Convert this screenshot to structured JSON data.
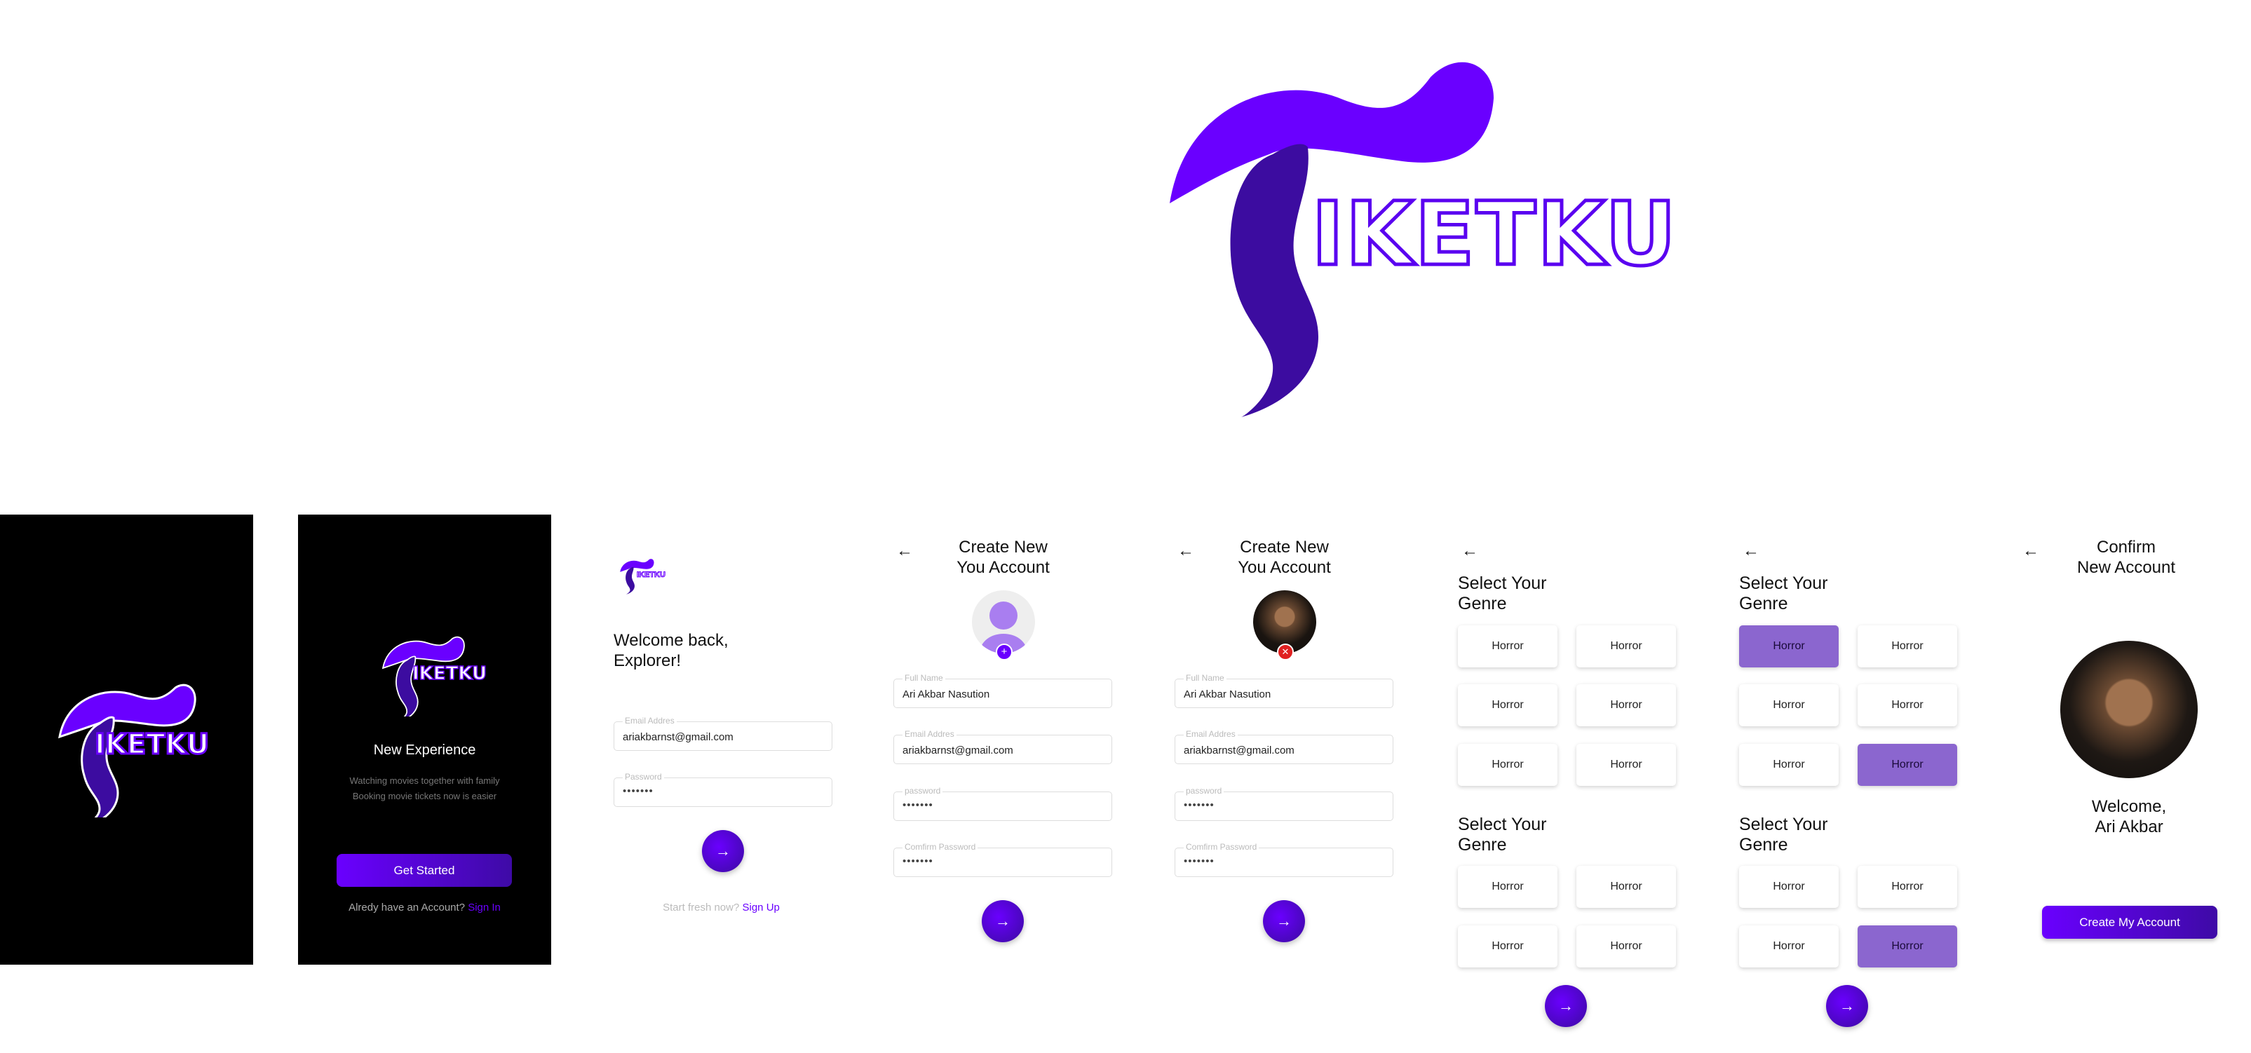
{
  "brand": {
    "name": "IKETKU",
    "logo_letter": "T"
  },
  "colors": {
    "accent": "#6a00ff",
    "accent_dark": "#3e0aa6",
    "selected_genre": "#8b66cf",
    "dark_bg": "#000000"
  },
  "icons": {
    "back": "arrow-left-icon",
    "next": "arrow-right-icon",
    "add_photo": "plus-circle-icon",
    "remove_photo": "close-circle-icon"
  },
  "splash": {
    "brand": "IKETKU"
  },
  "onboarding": {
    "brand": "IKETKU",
    "title": "New Experience",
    "subtitle_line1": "Watching movies together with family",
    "subtitle_line2": "Booking movie tickets now is easier",
    "cta_label": "Get Started",
    "signin_prompt": "Alredy have an Account?",
    "signin_link": "Sign In"
  },
  "login": {
    "brand": "IKETKU",
    "welcome_line1": "Welcome back,",
    "welcome_line2": "Explorer!",
    "email_label": "Email Addres",
    "email_value": "ariakbarnst@gmail.com",
    "password_label": "Password",
    "password_value": "•••••••",
    "signup_prompt": "Start fresh now?",
    "signup_link": "Sign Up"
  },
  "signup": {
    "title_line1": "Create New",
    "title_line2": "You Account",
    "fullname_label": "Full Name",
    "fullname_value": "Ari Akbar Nasution",
    "email_label": "Email Addres",
    "email_value": "ariakbarnst@gmail.com",
    "password_label": "password",
    "password_value": "•••••••",
    "confirm_label": "Comfirm Password",
    "confirm_value": "•••••••"
  },
  "genre": {
    "title_line1": "Select Your",
    "title_line2": "Genre",
    "item": "Horror",
    "selected_screen2": [
      0,
      5,
      9
    ]
  },
  "confirm": {
    "title_line1": "Confirm",
    "title_line2": "New Account",
    "welcome_line1": "Welcome,",
    "welcome_line2": "Ari Akbar",
    "cta_label": "Create My Account"
  }
}
